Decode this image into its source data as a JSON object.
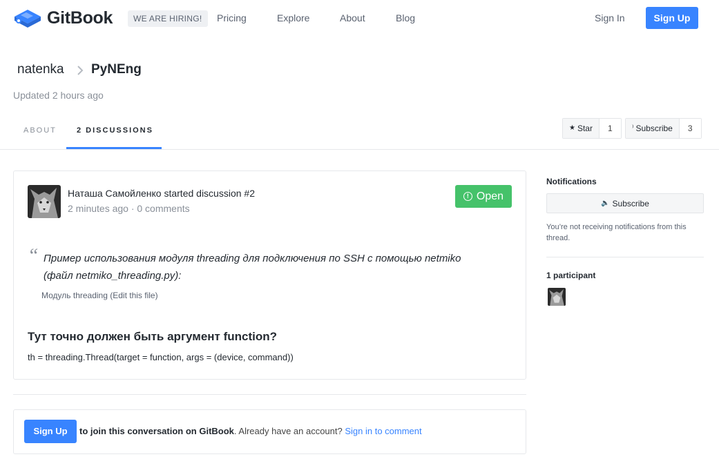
{
  "header": {
    "logo_text": "GitBook",
    "hiring_label": "WE ARE HIRING!",
    "nav": [
      "Pricing",
      "Explore",
      "About",
      "Blog"
    ],
    "signin_label": "Sign In",
    "signup_label": "Sign Up",
    "brand_color": "#3884ff"
  },
  "breadcrumb": {
    "owner": "natenka",
    "repo": "PyNEng"
  },
  "updated": "Updated 2 hours ago",
  "tabs": [
    {
      "label": "About",
      "active": false
    },
    {
      "label": "2 Discussions",
      "active": true
    }
  ],
  "actions": {
    "star": {
      "label": "Star",
      "icon": "star-icon",
      "count": "1"
    },
    "subscribe": {
      "label": "Subscribe",
      "icon": "rss-icon",
      "count": "3"
    }
  },
  "discussion": {
    "title": "Наташа Самойленко started discussion #2",
    "meta": "2 minutes ago · 0 comments",
    "status": "Open",
    "status_color": "#45c26a",
    "quote_mark": "“",
    "quote_text": "Пример использования модуля threading для подключения по SSH с помощью netmiko (файл netmiko_threading.py):",
    "quote_cite": "Модуль threading (Edit this file)",
    "question": "Тут точно должен быть аргумент function?",
    "code": "th = threading.Thread(target = function, args = (device, command))"
  },
  "join": {
    "signup_label": "Sign Up",
    "text_bold": "to join this conversation on GitBook",
    "text_mid": ". Already have an account? ",
    "link": "Sign in to comment"
  },
  "sidebar": {
    "notifications_title": "Notifications",
    "subscribe_label": "Subscribe",
    "subscribe_icon": "volume-icon",
    "note": "You’re not receiving notifications from this thread.",
    "participants_title": "1 participant"
  }
}
